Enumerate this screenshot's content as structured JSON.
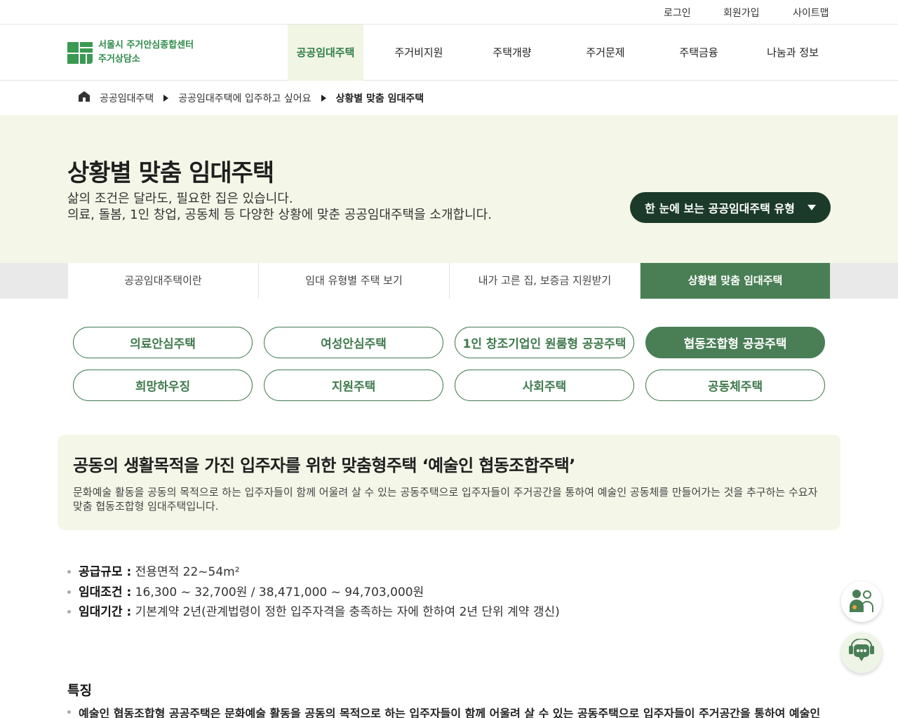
{
  "util": {
    "login": "로그인",
    "signup": "회원가입",
    "sitemap": "사이트맵"
  },
  "logo": {
    "line1": "서울시 주거안심종합센터",
    "line2": "주거상담소"
  },
  "nav": [
    {
      "label": "공공임대주택"
    },
    {
      "label": "주거비지원"
    },
    {
      "label": "주택개량"
    },
    {
      "label": "주거문제"
    },
    {
      "label": "주택금융"
    },
    {
      "label": "나눔과 정보"
    }
  ],
  "breadcrumb": [
    "공공임대주택",
    "공공임대주택에 입주하고 싶어요",
    "상황별 맞춤 임대주택"
  ],
  "hero": {
    "title": "상황별 맞춤 임대주택",
    "desc1": "삶의 조건은 달라도, 필요한 집은 있습니다.",
    "desc2": "의료, 돌봄, 1인 창업, 공동체 등 다양한 상황에 맞춘 공공임대주택을 소개합니다.",
    "button": "한 눈에 보는 공공임대주택 유형"
  },
  "subtabs": [
    {
      "label": "공공임대주택이란"
    },
    {
      "label": "임대 유형별 주택 보기"
    },
    {
      "label": "내가 고른 집, 보증금 지원받기"
    },
    {
      "label": "상황별 맞춤 임대주택"
    }
  ],
  "pills": [
    {
      "label": "의료안심주택"
    },
    {
      "label": "여성안심주택"
    },
    {
      "label": "1인 창조기업인 원룸형 공공주택"
    },
    {
      "label": "협동조합형 공공주택"
    },
    {
      "label": "희망하우징"
    },
    {
      "label": "지원주택"
    },
    {
      "label": "사회주택"
    },
    {
      "label": "공동체주택"
    }
  ],
  "card": {
    "title": "공동의 생활목적을 가진 입주자를 위한 맞춤형주택 ‘예술인 협동조합주택’",
    "desc": "문화예술 활동을 공동의 목적으로 하는 입주자들이 함께 어울려 살 수 있는 공동주택으로 입주자들이 주거공간을 통하여 예술인 공동체를 만들어가는 것을 추구하는 수요자 맞춤 협동조합형 임대주택입니다."
  },
  "specs": [
    {
      "label": "공급규모 :",
      "value": " 전용면적 22~54m²"
    },
    {
      "label": "임대조건 :",
      "value": " 16,300 ~ 32,700원 / 38,471,000 ~ 94,703,000원"
    },
    {
      "label": "임대기간 :",
      "value": " 기본계약 2년(관계법령이 정한 입주자격을 충족하는 자에 한하여 2년 단위 계약 갱신)"
    }
  ],
  "features": {
    "title": "특징",
    "item1": "예술인 협동조합형 공공주택은 문화예술 활동을 공동의 목적으로 하는 입주자들이 함께 어울려 살 수 있는 공동주택으로 입주자들이 주거공간을 통하여 예술인"
  },
  "colors": {
    "accent": "#4a7f56",
    "dark": "#1b3a2a",
    "hero_bg": "#f4f7e8"
  }
}
